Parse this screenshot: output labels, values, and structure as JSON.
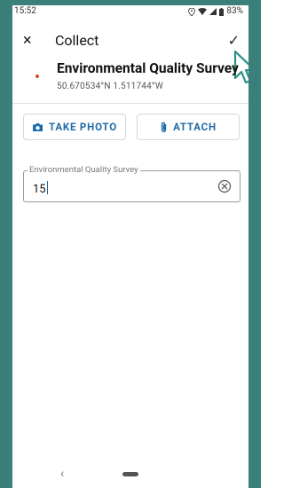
{
  "status": {
    "time": "15:52",
    "battery": "83%"
  },
  "appbar": {
    "close_icon": "×",
    "title": "Collect",
    "check_icon": "✓"
  },
  "header": {
    "form_title": "Environmental Quality Survey",
    "coordinates": "50.670534°N 1.511744°W"
  },
  "buttons": {
    "take_photo": "TAKE PHOTO",
    "attach": "ATTACH"
  },
  "field": {
    "label": "Environmental Quality Survey",
    "value": "15"
  },
  "navbar": {
    "back": "‹"
  },
  "colors": {
    "frame": "#3a7f7a",
    "accent": "#1e6aa6",
    "pin": "#d94a1e"
  }
}
